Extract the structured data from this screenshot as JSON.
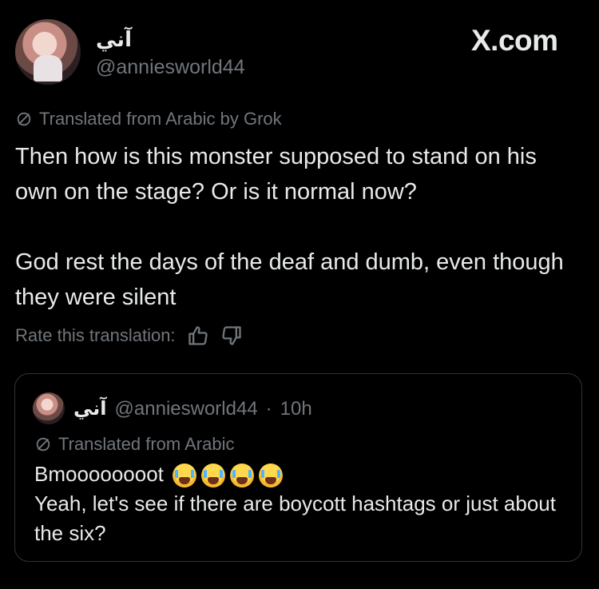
{
  "post": {
    "display_name": "آني",
    "handle": "@anniesworld44",
    "brand": "X.com",
    "translated_label": "Translated from Arabic by Grok",
    "paragraphs": [
      "Then how is this monster supposed to stand on his own on the stage? Or is it normal now?",
      "God rest the days of the deaf and dumb, even though they were silent"
    ],
    "rate_label": "Rate this translation:"
  },
  "quote": {
    "display_name": "آني",
    "handle": "@anniesworld44",
    "separator": "·",
    "time": "10h",
    "translated_label": "Translated from Arabic",
    "line1": "Bmoooooooot",
    "emoji_names": [
      "loudly-crying-face",
      "loudly-crying-face",
      "loudly-crying-face",
      "loudly-crying-face"
    ],
    "line2": "Yeah, let's see if there are boycott hashtags or just about the six?"
  },
  "colors": {
    "background": "#000000",
    "text_primary": "#e7e9ea",
    "text_secondary": "#71767b",
    "border": "#2f3336"
  }
}
